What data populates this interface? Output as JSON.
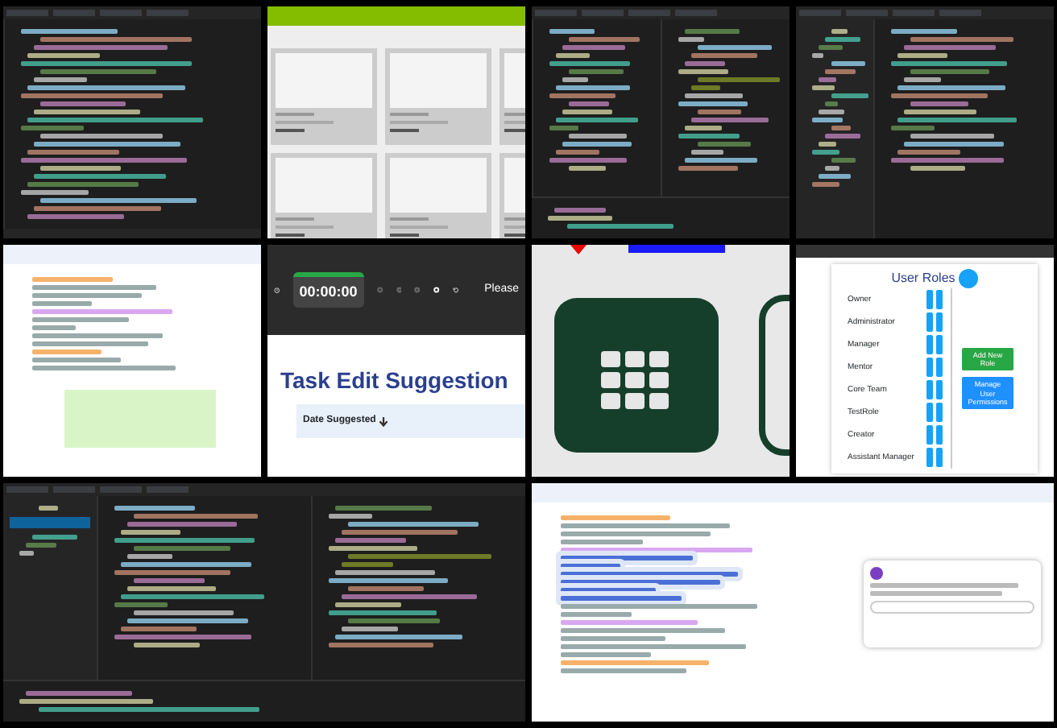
{
  "tiles": [
    {
      "kind": "code_editor"
    },
    {
      "kind": "listing_page"
    },
    {
      "kind": "diff_editor"
    },
    {
      "kind": "explorer_editor"
    },
    {
      "kind": "document_editor"
    },
    {
      "kind": "timer_page",
      "timer": "00:00:00",
      "prompt": "Please",
      "title": "Task Edit Suggestion",
      "column": "Date Suggested"
    },
    {
      "kind": "app_icon"
    },
    {
      "kind": "roles_page",
      "title": "User Roles",
      "roles": [
        "Owner",
        "Administrator",
        "Manager",
        "Mentor",
        "Core Team",
        "TestRole",
        "Creator",
        "Assistant Manager"
      ],
      "buttons": [
        "Add New Role",
        "Manage User Permissions"
      ]
    },
    {
      "kind": "source_control_editor"
    },
    {
      "kind": "document_comment"
    }
  ]
}
